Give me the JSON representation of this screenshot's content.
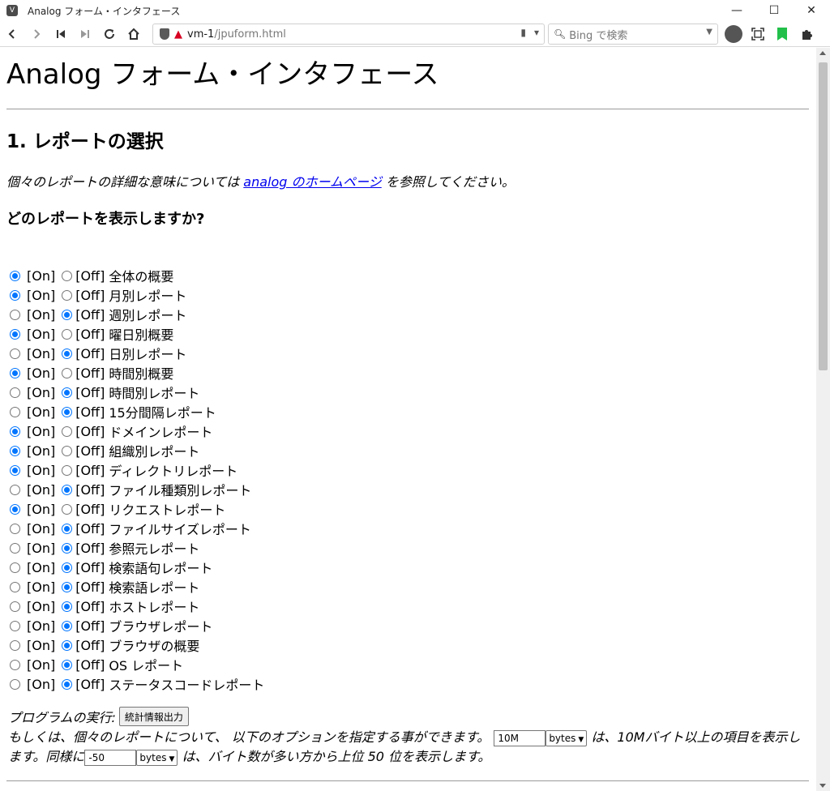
{
  "window": {
    "title": "Analog フォーム・インタフェース",
    "minimize": "—",
    "maximize": "☐",
    "close": "✕"
  },
  "toolbar": {
    "url_host": "vm-1",
    "url_path": "/jpuform.html",
    "search_placeholder": "Bing で検索"
  },
  "page": {
    "title": "Analog フォーム・インタフェース",
    "section_title": "1. レポートの選択",
    "intro_before": "個々のレポートの詳細な意味については ",
    "intro_link": "analog のホームページ",
    "intro_after": " を参照してください。",
    "question": "どのレポートを表示しますか?",
    "on_label": "[On]",
    "off_label": "[Off]",
    "reports": [
      {
        "name": "全体の概要",
        "on": true
      },
      {
        "name": "月別レポート",
        "on": true
      },
      {
        "name": "週別レポート",
        "on": false
      },
      {
        "name": "曜日別概要",
        "on": true
      },
      {
        "name": "日別レポート",
        "on": false
      },
      {
        "name": "時間別概要",
        "on": true
      },
      {
        "name": "時間別レポート",
        "on": false
      },
      {
        "name": "15分間隔レポート",
        "on": false
      },
      {
        "name": "ドメインレポート",
        "on": true
      },
      {
        "name": "組織別レポート",
        "on": true
      },
      {
        "name": "ディレクトリレポート",
        "on": true
      },
      {
        "name": "ファイル種類別レポート",
        "on": false
      },
      {
        "name": "リクエストレポート",
        "on": true
      },
      {
        "name": "ファイルサイズレポート",
        "on": false
      },
      {
        "name": "参照元レポート",
        "on": false
      },
      {
        "name": "検索語句レポート",
        "on": false
      },
      {
        "name": "検索語レポート",
        "on": false
      },
      {
        "name": "ホストレポート",
        "on": false
      },
      {
        "name": "ブラウザレポート",
        "on": false
      },
      {
        "name": "ブラウザの概要",
        "on": false
      },
      {
        "name": "OS レポート",
        "on": false
      },
      {
        "name": "ステータスコードレポート",
        "on": false
      }
    ],
    "run_label": "プログラムの実行:",
    "run_button": "統計情報出力",
    "options_text1": "もしくは、個々のレポートについて、 以下のオプションを指定する事ができます。",
    "size_value": "10M",
    "size_unit": "bytes",
    "options_text2": " は、10Mバイト以上の項目を表示します。同様に",
    "top_value": "-50",
    "top_unit": "bytes",
    "options_text3": " は、バイト数が多い方から上位 50 位を表示します。"
  }
}
